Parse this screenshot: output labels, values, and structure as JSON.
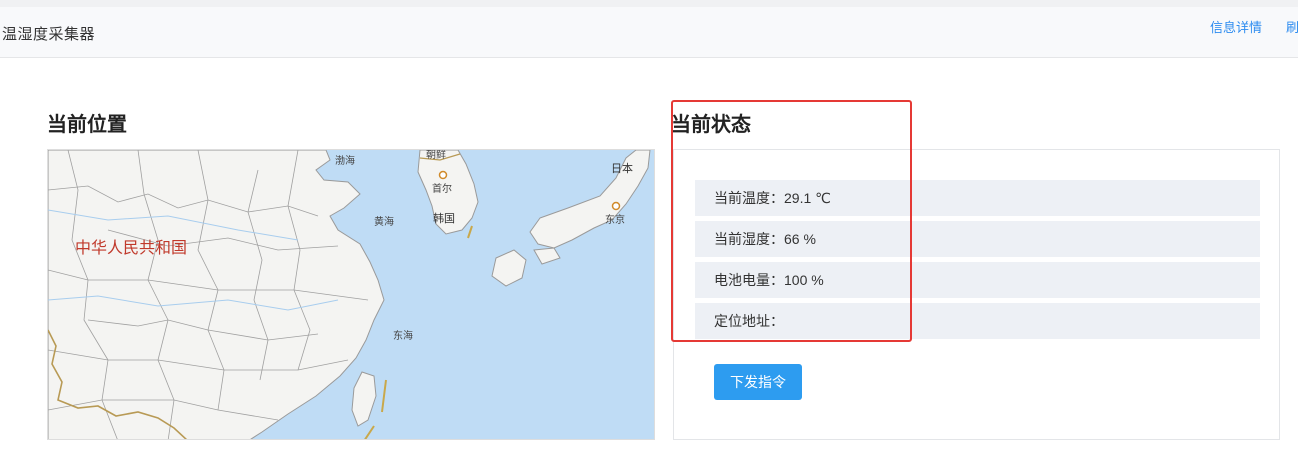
{
  "header": {
    "app_title": "温湿度采集器",
    "links": {
      "info_detail": "信息详情",
      "refresh": "刷"
    }
  },
  "location": {
    "title": "当前位置",
    "map": {
      "country": "中华人民共和国",
      "labels": {
        "bohai": "渤海",
        "north_korea": "朝鲜",
        "seoul": "首尔",
        "yellow_sea": "黄海",
        "korea": "韩国",
        "japan": "日本",
        "tokyo": "东京",
        "east_sea": "东海"
      },
      "colors": {
        "sea": "#bfdcf5",
        "land": "#f4f4f2",
        "border": "#8a8a8a",
        "country_border": "#b89a55",
        "city_marker": "#d08a2a"
      }
    }
  },
  "status": {
    "title": "当前状态",
    "rows": {
      "temperature": "当前温度：29.1 ℃",
      "humidity": "当前湿度：66 %",
      "battery": "电池电量：100 %",
      "address": "定位地址："
    },
    "send_command_label": "下发指令"
  },
  "colors": {
    "accent": "#2d9cf0",
    "link": "#2d8cf0",
    "highlight": "#e53935",
    "row_bg": "#edf0f5"
  }
}
